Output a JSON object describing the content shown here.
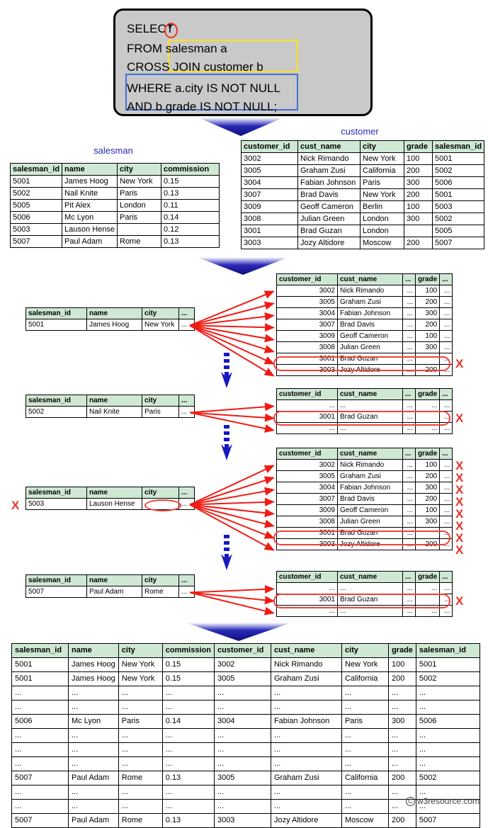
{
  "query": {
    "lines": [
      "SELECT",
      "FROM    salesman a",
      "CROSS JOIN customer b",
      "WHERE a.city IS NOT NULL",
      "AND b.grade IS NOT NULL;"
    ],
    "star": "*",
    "highlight_from_color": "#ffe11a",
    "highlight_where_color": "#3f6fd8",
    "star_circle_color": "#e8322a"
  },
  "salesman_table": {
    "caption": "salesman",
    "headers": [
      "salesman_id",
      "name",
      "city",
      "commission"
    ],
    "rows": [
      [
        "5001",
        "James Hoog",
        "New York",
        "0.15"
      ],
      [
        "5002",
        "Nail Knite",
        "Paris",
        "0.13"
      ],
      [
        "5005",
        "Pit Alex",
        "London",
        "0.11"
      ],
      [
        "5006",
        "Mc Lyon",
        "Paris",
        "0.14"
      ],
      [
        "5003",
        "Lauson Hense",
        "",
        "0.12"
      ],
      [
        "5007",
        "Paul Adam",
        "Rome",
        "0.13"
      ]
    ]
  },
  "customer_table": {
    "caption": "customer",
    "headers": [
      "customer_id",
      "cust_name",
      "city",
      "grade",
      "salesman_id"
    ],
    "rows": [
      [
        "3002",
        "Nick Rimando",
        "New York",
        "100",
        "5001"
      ],
      [
        "3005",
        "Graham Zusi",
        "California",
        "200",
        "5002"
      ],
      [
        "3004",
        "Fabian Johnson",
        "Paris",
        "300",
        "5006"
      ],
      [
        "3007",
        "Brad Davis",
        "New York",
        "200",
        "5001"
      ],
      [
        "3009",
        "Geoff Cameron",
        "Berlin",
        "100",
        "5003"
      ],
      [
        "3008",
        "Julian Green",
        "London",
        "300",
        "5002"
      ],
      [
        "3001",
        "Brad Guzan",
        "London",
        "",
        "5005"
      ],
      [
        "3003",
        "Jozy Altidore",
        "Moscow",
        "200",
        "5007"
      ]
    ]
  },
  "blocks": [
    {
      "salesman_headers": [
        "salesman_id",
        "name",
        "city",
        "..."
      ],
      "salesman_row": [
        "5001",
        "James Hoog",
        "New York",
        "..."
      ],
      "salesman_flagged": false,
      "customer_headers": [
        "customer_id",
        "cust_name",
        "...",
        "grade",
        "..."
      ],
      "customer_rows": [
        [
          "3002",
          "Nick Rimando",
          "...",
          "100",
          "..."
        ],
        [
          "3005",
          "Graham Zusi",
          "...",
          "200",
          "..."
        ],
        [
          "3004",
          "Fabian Johnson",
          "...",
          "300",
          "..."
        ],
        [
          "3007",
          "Brad Davis",
          "...",
          "200",
          "..."
        ],
        [
          "3009",
          "Geoff Cameron",
          "...",
          "100",
          "..."
        ],
        [
          "3008",
          "Julian Green",
          "...",
          "300",
          "..."
        ],
        [
          "3001",
          "Brad Guzan",
          "...",
          "",
          "..."
        ],
        [
          "3003",
          "Jozy Altidore",
          "...",
          "200",
          "..."
        ]
      ],
      "circled_row_index": 6,
      "x_row_indices": [
        6
      ]
    },
    {
      "salesman_headers": [
        "salesman_id",
        "name",
        "city",
        "..."
      ],
      "salesman_row": [
        "5002",
        "Nail Knite",
        "Paris",
        "..."
      ],
      "salesman_flagged": false,
      "customer_headers": [
        "customer_id",
        "cust_name",
        "...",
        "grade",
        "..."
      ],
      "customer_rows": [
        [
          "...",
          "...",
          "...",
          "...",
          "..."
        ],
        [
          "3001",
          "Brad Guzan",
          "...",
          "",
          "..."
        ],
        [
          "...",
          "...",
          "...",
          "...",
          "..."
        ]
      ],
      "circled_row_index": 1,
      "x_row_indices": [
        1
      ]
    },
    {
      "salesman_headers": [
        "salesman_id",
        "name",
        "city",
        "..."
      ],
      "salesman_row": [
        "5003",
        "Lauson Hense",
        "",
        "..."
      ],
      "salesman_flagged": true,
      "customer_headers": [
        "customer_id",
        "cust_name",
        "...",
        "grade",
        "..."
      ],
      "customer_rows": [
        [
          "3002",
          "Nick Rimando",
          "...",
          "100",
          "..."
        ],
        [
          "3005",
          "Graham Zusi",
          "...",
          "200",
          "..."
        ],
        [
          "3004",
          "Fabian Johnson",
          "...",
          "300",
          "..."
        ],
        [
          "3007",
          "Brad Davis",
          "...",
          "200",
          "..."
        ],
        [
          "3009",
          "Geoff Cameron",
          "...",
          "100",
          "..."
        ],
        [
          "3008",
          "Julian Green",
          "...",
          "300",
          "..."
        ],
        [
          "3001",
          "Brad Guzan",
          "...",
          "",
          "..."
        ],
        [
          "3003",
          "Jozy Altidore",
          "...",
          "200",
          "..."
        ]
      ],
      "circled_row_index": 6,
      "x_row_indices": [
        0,
        1,
        2,
        3,
        4,
        5,
        6,
        7
      ]
    },
    {
      "salesman_headers": [
        "salesman_id",
        "name",
        "city",
        "..."
      ],
      "salesman_row": [
        "5007",
        "Paul Adam",
        "Rome",
        "..."
      ],
      "salesman_flagged": false,
      "customer_headers": [
        "customer_id",
        "cust_name",
        "...",
        "grade",
        "..."
      ],
      "customer_rows": [
        [
          "...",
          "...",
          "...",
          "...",
          "..."
        ],
        [
          "3001",
          "Brad Guzan",
          "...",
          "",
          "..."
        ],
        [
          "...",
          "...",
          "...",
          "...",
          "..."
        ]
      ],
      "circled_row_index": 1,
      "x_row_indices": [
        1
      ]
    }
  ],
  "result_table": {
    "headers": [
      "salesman_id",
      "name",
      "city",
      "commission",
      "customer_id",
      "cust_name",
      "city",
      "grade",
      "salesman_id"
    ],
    "rows": [
      [
        "5001",
        "James Hoog",
        "New York",
        "0.15",
        "3002",
        "Nick Rimando",
        "New York",
        "100",
        "5001"
      ],
      [
        "5001",
        "James Hoog",
        "New York",
        "0.15",
        "3005",
        "Graham Zusi",
        "California",
        "200",
        "5002"
      ],
      [
        "...",
        "...",
        "...",
        "...",
        "...",
        "...",
        "...",
        "...",
        "..."
      ],
      [
        "...",
        "...",
        "...",
        "...",
        "...",
        "...",
        "...",
        "...",
        "..."
      ],
      [
        "5006",
        "Mc Lyon",
        "Paris",
        "0.14",
        "3004",
        "Fabian Johnson",
        "Paris",
        "300",
        "5006"
      ],
      [
        "...",
        "...",
        "...",
        "...",
        "...",
        "...",
        "...",
        "...",
        "..."
      ],
      [
        "...",
        "...",
        "...",
        "...",
        "...",
        "...",
        "...",
        "...",
        "..."
      ],
      [
        "...",
        "...",
        "...",
        "...",
        "...",
        "...",
        "...",
        "...",
        "..."
      ],
      [
        "5007",
        "Paul Adam",
        "Rome",
        "0.13",
        "3005",
        "Graham Zusi",
        "California",
        "200",
        "5002"
      ],
      [
        "...",
        "...",
        "...",
        "...",
        "...",
        "...",
        "...",
        "...",
        "..."
      ],
      [
        "...",
        "...",
        "...",
        "...",
        "...",
        "...",
        "...",
        "...",
        "..."
      ],
      [
        "5007",
        "Paul Adam",
        "Rome",
        "0.13",
        "3003",
        "Jozy Altidore",
        "Moscow",
        "200",
        "5007"
      ]
    ]
  },
  "watermark": {
    "symbol": "C",
    "text": "w3resource.com"
  }
}
